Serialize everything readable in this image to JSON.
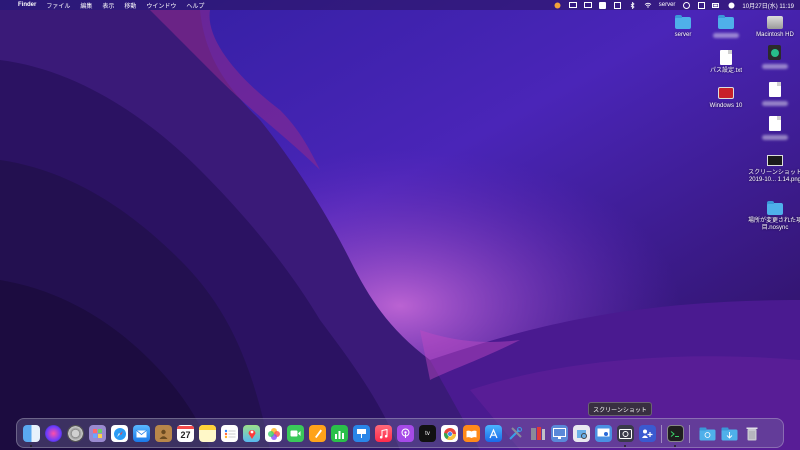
{
  "menubar": {
    "apple": "",
    "app": "Finder",
    "items": [
      "ファイル",
      "編集",
      "表示",
      "移動",
      "ウインドウ",
      "ヘルプ"
    ],
    "status_label": "server",
    "clock": "10月27日(水) 11:19"
  },
  "desktop_icons": {
    "server": "server",
    "macintosh_hd": "Macintosh HD",
    "pass_file": "パス設定.txt",
    "windows10": "Windows 10",
    "screenshot": "スクリーンショット\n2019-10... 1.14.png",
    "moved_folder": "場所が変更された項\n目.nosync"
  },
  "dock": {
    "tooltip": "スクリーンショット",
    "calendar_day": "27",
    "tv_label": "tv"
  },
  "colors": {
    "wallpaper_top": "#3b1b9b",
    "wallpaper_bottom": "#2a0f55",
    "highlight": "#b040c0"
  }
}
